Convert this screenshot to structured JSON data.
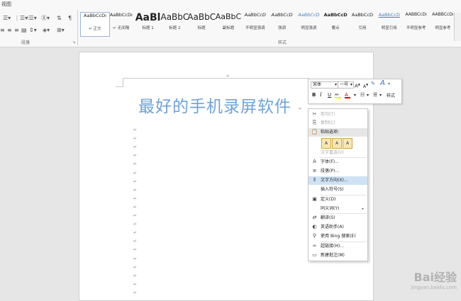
{
  "ribbon": {
    "tab_hint": "视图",
    "paragraph_group_label": "段落",
    "styles_group_label": "样式",
    "styles": [
      {
        "preview": "AaBbCcDı",
        "name": "↵ 正文"
      },
      {
        "preview": "AaBbCcDı",
        "name": "↵ 无间隔"
      },
      {
        "preview": "AaBl",
        "name": "标题 1"
      },
      {
        "preview": "AaBbC",
        "name": "标题 2"
      },
      {
        "preview": "AaBbC",
        "name": "标题"
      },
      {
        "preview": "AaBbC",
        "name": "副标题"
      },
      {
        "preview": "AaBbCcD",
        "name": "不明显强调"
      },
      {
        "preview": "AaBbCcD",
        "name": "强调"
      },
      {
        "preview": "AaBbCcD",
        "name": "明显强调"
      },
      {
        "preview": "AaBbCcD",
        "name": "要点"
      },
      {
        "preview": "AaBbCcD",
        "name": "引用"
      },
      {
        "preview": "AaBbCcD",
        "name": "明显引用"
      },
      {
        "preview": "AABBCcDı",
        "name": "不明显参考"
      },
      {
        "preview": "AABBCcDı",
        "name": "明显参考"
      }
    ]
  },
  "document": {
    "title": "最好的手机录屏软件",
    "para_mark": "↵"
  },
  "mini_toolbar": {
    "font_name": "宋体",
    "font_size": "一号",
    "grow": "A",
    "shrink": "A",
    "bold": "B",
    "italic": "I",
    "underline": "U",
    "styles_label": "样式"
  },
  "context_menu": {
    "items": [
      {
        "label": "剪切(T)",
        "icon": "✂",
        "disabled": true
      },
      {
        "label": "复制(C)",
        "icon": "⎘",
        "disabled": true
      },
      {
        "label": "粘贴选项:",
        "icon": "📋",
        "header": true
      },
      {
        "label": "汉字重选(V)",
        "disabled": true
      },
      {
        "label": "字体(F)...",
        "icon": "A"
      },
      {
        "label": "段落(P)...",
        "icon": "≡"
      },
      {
        "label": "文字方向(X)...",
        "icon": "⫴",
        "highlight": true
      },
      {
        "label": "插入符号(S)"
      },
      {
        "label": "定义(D)",
        "icon": "▣"
      },
      {
        "label": "同义词(Y)",
        "submenu": true
      },
      {
        "label": "翻译(S)",
        "icon": "⇄"
      },
      {
        "label": "英语助手(A)",
        "icon": "◐"
      },
      {
        "label": "使用 Bing 搜索(E)",
        "icon": "⚲"
      },
      {
        "label": "超链接(H)...",
        "icon": "∞"
      },
      {
        "label": "新建批注(M)",
        "icon": "▭"
      }
    ],
    "paste_options": [
      "A",
      "A",
      "A"
    ]
  },
  "watermark": {
    "text": "Bai经验",
    "url": "jingyan.baidu.com"
  }
}
